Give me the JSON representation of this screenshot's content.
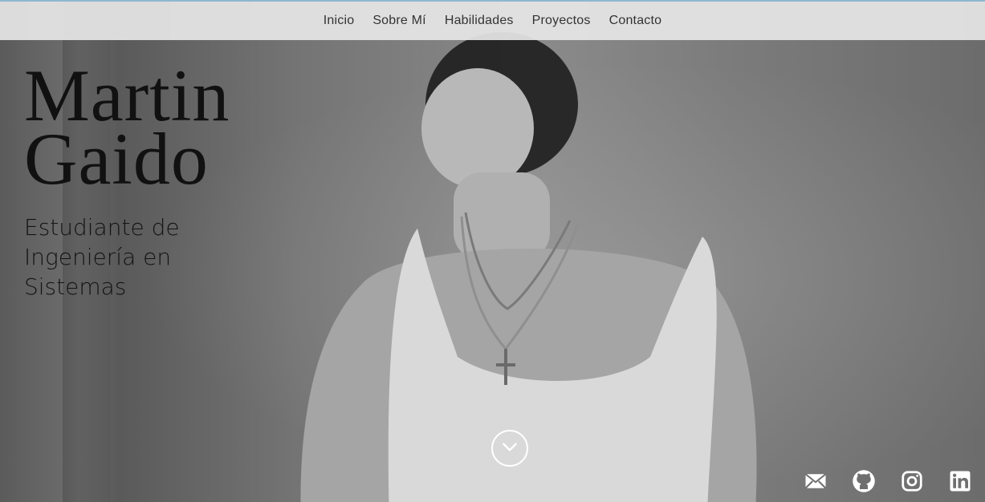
{
  "nav": {
    "items": [
      {
        "label": "Inicio"
      },
      {
        "label": "Sobre Mí"
      },
      {
        "label": "Habilidades"
      },
      {
        "label": "Proyectos"
      },
      {
        "label": "Contacto"
      }
    ]
  },
  "hero": {
    "name_line1": "Martin",
    "name_line2": "Gaido",
    "subtitle_line1": "Estudiante de",
    "subtitle_line2": "Ingeniería en",
    "subtitle_line3": "Sistemas"
  },
  "icons": {
    "scroll": "chevron-down-icon",
    "social": [
      "mail-icon",
      "github-icon",
      "instagram-icon",
      "linkedin-icon"
    ]
  },
  "colors": {
    "nav_background": "#e7e7e7",
    "nav_accent": "#8fb6d0",
    "text_dark": "#111111",
    "icon_white": "#ffffff"
  }
}
